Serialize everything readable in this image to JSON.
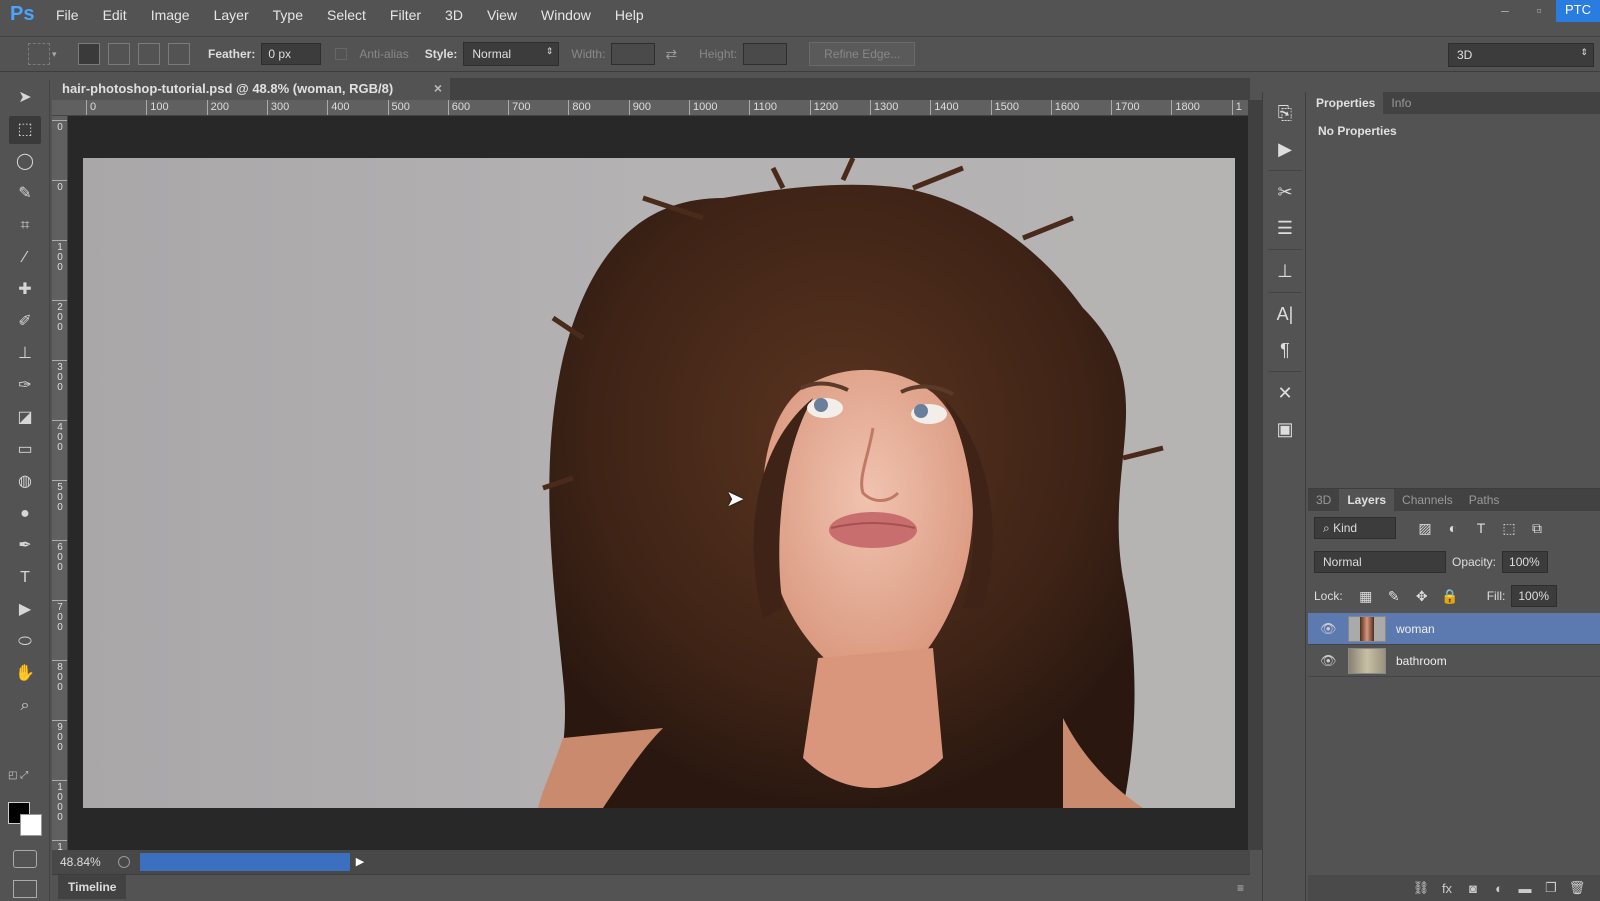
{
  "app": {
    "logo": "Ps",
    "badge": "PTC"
  },
  "menu": [
    "File",
    "Edit",
    "Image",
    "Layer",
    "Type",
    "Select",
    "Filter",
    "3D",
    "View",
    "Window",
    "Help"
  ],
  "options": {
    "feather_label": "Feather:",
    "feather_value": "0 px",
    "antialias_label": "Anti-alias",
    "style_label": "Style:",
    "style_value": "Normal",
    "width_label": "Width:",
    "height_label": "Height:",
    "refine_edge": "Refine Edge...",
    "workspace": "3D"
  },
  "document": {
    "tab_title": "hair-photoshop-tutorial.psd @ 48.8% (woman, RGB/8)",
    "close": "×",
    "ruler_h": [
      "0",
      "100",
      "200",
      "300",
      "400",
      "500",
      "600",
      "700",
      "800",
      "900",
      "1000",
      "1100",
      "1200",
      "1300",
      "1400",
      "1500",
      "1600",
      "1700",
      "1800",
      "1"
    ],
    "ruler_v": [
      "0",
      "0",
      "1 0 0",
      "2 0 0",
      "3 0 0",
      "4 0 0",
      "5 0 0",
      "6 0 0",
      "7 0 0",
      "8 0 0",
      "9 0 0",
      "1 0 0 0",
      "1"
    ]
  },
  "status": {
    "zoom": "48.84%",
    "progress": 1.0
  },
  "timeline": {
    "label": "Timeline"
  },
  "properties_panel": {
    "tabs": [
      "Properties",
      "Info"
    ],
    "body": "No Properties"
  },
  "layers_panel": {
    "tabs": [
      "3D",
      "Layers",
      "Channels",
      "Paths"
    ],
    "kind": "Kind",
    "blend_mode": "Normal",
    "opacity_label": "Opacity:",
    "opacity_value": "100%",
    "lock_label": "Lock:",
    "fill_label": "Fill:",
    "fill_value": "100%",
    "layers": [
      {
        "name": "woman",
        "selected": true
      },
      {
        "name": "bathroom",
        "selected": false
      }
    ]
  },
  "colors": {
    "accent": "#2a7de0",
    "selected_layer": "#5c7ab0",
    "progress": "#3b6fbf"
  }
}
